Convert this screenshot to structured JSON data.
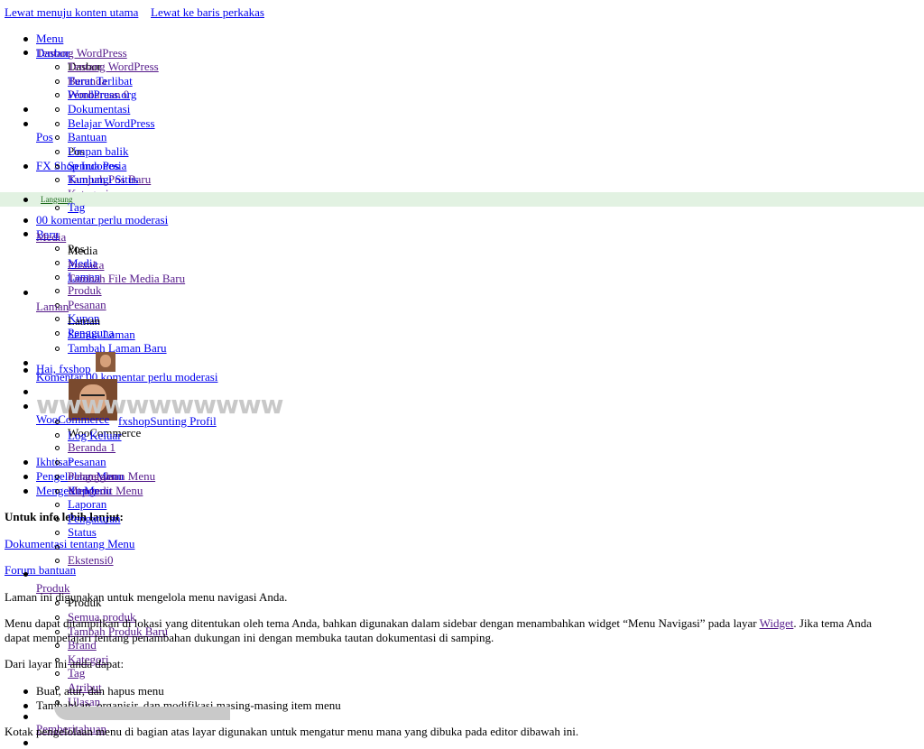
{
  "skip_links": [
    "Lewat menuju konten utama",
    "Lewat ke baris perkakas"
  ],
  "top_menu": {
    "menu": "Menu",
    "tentang": "Tentang WordPress",
    "dashboard": "Dasbor",
    "wp_sub": [
      "Tentang WordPress",
      "Turut Terlibat",
      "WordPress.org",
      "Dokumentasi",
      "Belajar WordPress",
      "Bantuan",
      "Umpan balik"
    ],
    "beranda": "Beranda",
    "pembaruan": "Pembaruan 0",
    "site": "FX Shop Indonesia",
    "kunjungi_situs": "Kunjungi Situs",
    "updates": "Pembaruan",
    "komentar": "00 komentar perlu moderasi",
    "baru": "Baru",
    "baru_sub": [
      "Pos",
      "Media",
      "Laman",
      "Produk",
      "Pesanan",
      "Kupon",
      "Pengguna"
    ],
    "language": "Langsung",
    "hai": "Hai, fxshop",
    "profile": "fxshopSunting Profil",
    "logout": "Log Keluar"
  },
  "watermark": "wwwwwwwwwww",
  "admin_menu": {
    "pos": "Pos",
    "pos_sub": [
      "Pos",
      "Semua Pos",
      "Tambah Pos Baru",
      "Kategori",
      "Tag"
    ],
    "media": "Media",
    "media_sub": [
      "Media",
      "Pustaka",
      "Tambah File Media Baru"
    ],
    "laman": "Laman",
    "laman_sub": [
      "Laman",
      "Semua Laman",
      "Tambah Laman Baru"
    ],
    "komentar": "Komentar 00 komentar perlu moderasi",
    "woocommerce": "WooCommerce",
    "woo_sub": [
      "WooCommerce",
      "Beranda 1",
      "Pesanan",
      "Pelanggan",
      "Kupon",
      "Laporan",
      "Pengaturan",
      "Status",
      "Ekstensi0"
    ],
    "produk": "Produk",
    "produk_sub": [
      "Produk",
      "Semua produk",
      "Tambah Produk Baru",
      "Brand",
      "Kategori",
      "Tag",
      "Atribut",
      "Ulasan"
    ],
    "pemberitahuan": "Pemberitahuan"
  },
  "help": {
    "ikhtisar": "Ikhtisar",
    "pengelolaan": "Pengelolaan Menu",
    "mengedit": "Mengedit Menu",
    "pengelolaan_tab": "Pengelolaan Menu",
    "mengedit_tab": "Mengedit Menu",
    "info_heading": "Untuk info lebih lanjut:",
    "doc_link": "Dokumentasi tentang Menu",
    "forum_link": "Forum bantuan",
    "p1": "Laman ini digunakan untuk mengelola menu navigasi Anda.",
    "p2_line1_before": "Menu dapat ditampilkan di lokasi yang ditentukan oleh tema Anda, bahkan digunakan dalam sidebar dengan menambahkan widget “Menu Navigasi” pada layar ",
    "p2_link": "Widget",
    "p2_line1_after": ". Jika tema Anda",
    "p2_line2": "dapat mempelajari tentang penambahan dukungan ini dengan membuka tautan dokumentasi di samping.",
    "p3": "Dari layar ini anda dapat:",
    "list": [
      "Buat, atur, dan hapus menu",
      "Tambahkan, organisir, dan modifikasi masing-masing item menu"
    ],
    "p4": "Kotak pengelolaan menu di bagian atas layar digunakan untuk mengatur menu mana yang dibuka pada editor dibawah ini."
  }
}
